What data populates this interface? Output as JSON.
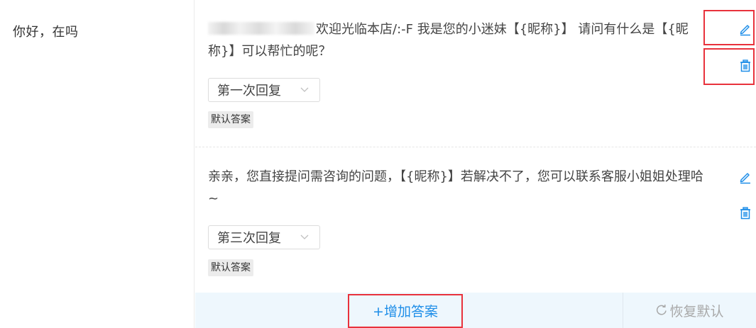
{
  "question": {
    "text": "你好，在吗"
  },
  "answers": [
    {
      "text_after_blur": "欢迎光临本店/:-F 我是您的小迷妹【{昵称}】 请问有什么是【{昵称}】可以帮忙的呢？",
      "order_label": "第一次回复",
      "tag": "默认答案",
      "edit_icon": "pencil-icon",
      "delete_icon": "trash-icon"
    },
    {
      "text": "亲亲，您直接提问需咨询的问题，【{昵称}】若解决不了，您可以联系客服小姐姐处理哈~",
      "order_label": "第三次回复",
      "tag": "默认答案",
      "edit_icon": "pencil-icon",
      "delete_icon": "trash-icon"
    }
  ],
  "footer": {
    "add_label": "+增加答案",
    "restore_label": "恢复默认",
    "restore_icon": "refresh-icon"
  },
  "colors": {
    "accent_blue": "#1e8ee8",
    "highlight_red": "#e8323c",
    "footer_bg": "#eef7fd",
    "muted_gray": "#a8a8a8"
  }
}
